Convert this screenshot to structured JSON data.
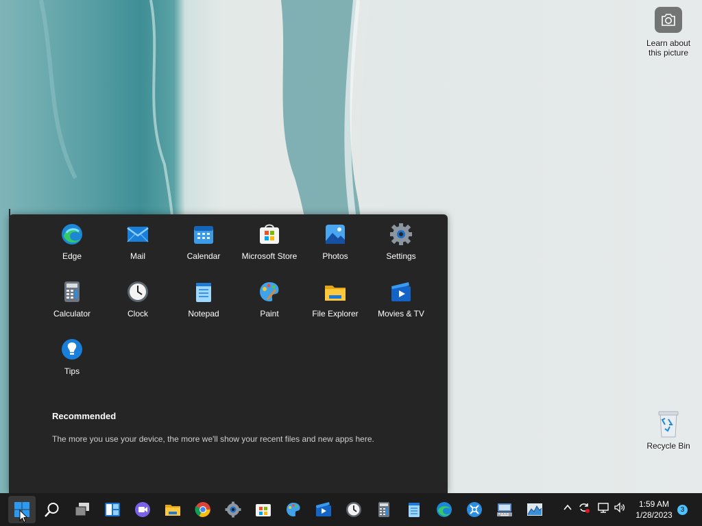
{
  "desktop": {
    "spotlight_label": "Learn about this picture",
    "recycle_bin_label": "Recycle Bin"
  },
  "start_menu": {
    "pinned": [
      {
        "label": "Edge",
        "icon": "edge-icon"
      },
      {
        "label": "Mail",
        "icon": "mail-icon"
      },
      {
        "label": "Calendar",
        "icon": "calendar-icon"
      },
      {
        "label": "Microsoft Store",
        "icon": "store-icon"
      },
      {
        "label": "Photos",
        "icon": "photos-icon"
      },
      {
        "label": "Settings",
        "icon": "settings-icon"
      },
      {
        "label": "Calculator",
        "icon": "calculator-icon"
      },
      {
        "label": "Clock",
        "icon": "clock-icon"
      },
      {
        "label": "Notepad",
        "icon": "notepad-icon"
      },
      {
        "label": "Paint",
        "icon": "paint-icon"
      },
      {
        "label": "File Explorer",
        "icon": "folder-icon"
      },
      {
        "label": "Movies & TV",
        "icon": "movies-icon"
      },
      {
        "label": "Tips",
        "icon": "tips-icon"
      }
    ],
    "recommended_title": "Recommended",
    "recommended_text": "The more you use your device, the more we'll show your recent files and new apps here."
  },
  "taskbar": {
    "apps": [
      "start-icon",
      "search-icon",
      "task-view-icon",
      "widgets-icon",
      "chat-icon",
      "folder-icon",
      "chrome-icon",
      "settings-icon",
      "store-icon",
      "paint-icon",
      "movies-icon",
      "clock-icon",
      "calculator-icon",
      "notepad-icon",
      "edge-icon",
      "snipping-icon",
      "keyboard-icon",
      "performance-icon"
    ],
    "time": "1:59 AM",
    "date": "1/28/2023",
    "notification_count": "3"
  },
  "colors": {
    "accent": "#0078d4",
    "start_bg": "#252525",
    "taskbar_bg": "#1c1c1c",
    "badge": "#4cc2ff"
  }
}
